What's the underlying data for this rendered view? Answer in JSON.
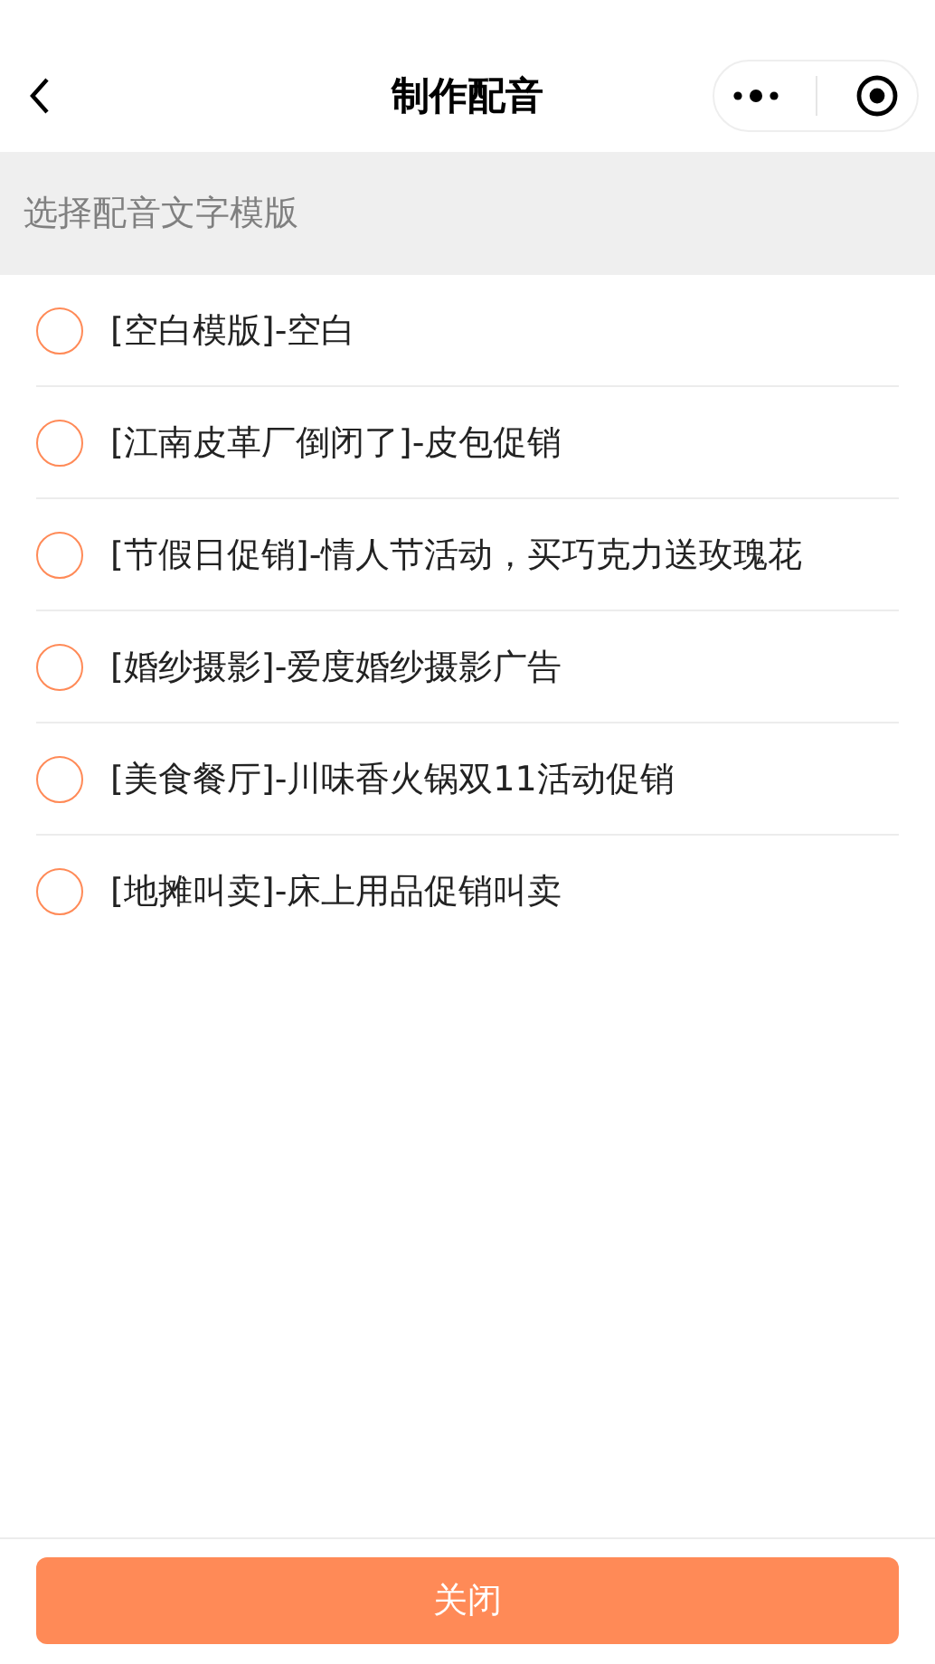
{
  "nav": {
    "title": "制作配音"
  },
  "section_header": "选择配音文字模版",
  "options": [
    {
      "label": "[空白模版]-空白",
      "selected": false
    },
    {
      "label": "[江南皮革厂倒闭了]-皮包促销",
      "selected": false
    },
    {
      "label": "[节假日促销]-情人节活动，买巧克力送玫瑰花",
      "selected": false
    },
    {
      "label": "[婚纱摄影]-爱度婚纱摄影广告",
      "selected": false
    },
    {
      "label": "[美食餐厅]-川味香火锅双11活动促销",
      "selected": false
    },
    {
      "label": "[地摊叫卖]-床上用品促销叫卖",
      "selected": false
    }
  ],
  "close_button": "关闭"
}
